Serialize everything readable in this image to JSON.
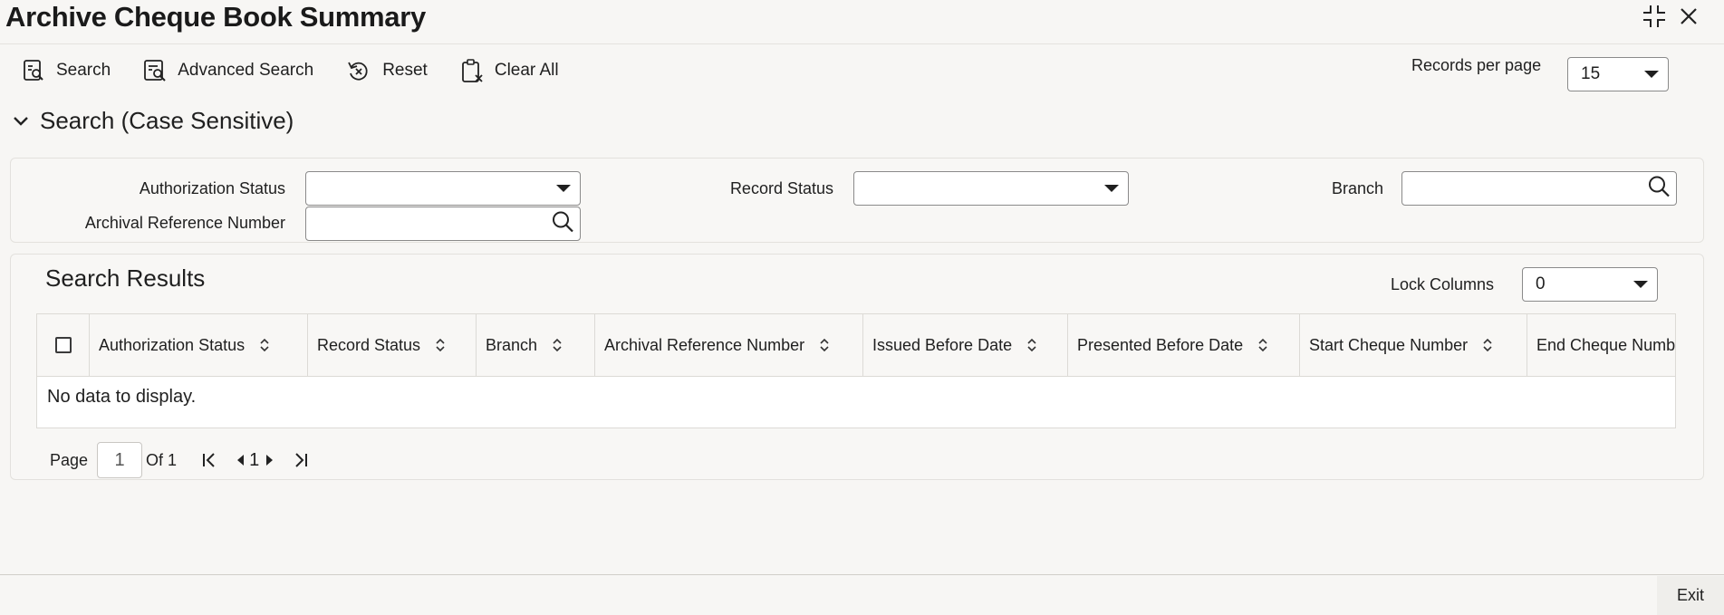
{
  "window": {
    "title": "Archive Cheque Book Summary",
    "icons": {
      "minimize": "minimize-icon",
      "close": "close-icon"
    }
  },
  "toolbar": {
    "search_label": "Search",
    "advanced_search_label": "Advanced Search",
    "reset_label": "Reset",
    "clear_all_label": "Clear All",
    "records_per_page_label": "Records per page",
    "records_per_page_value": "15"
  },
  "search_section": {
    "title": "Search (Case Sensitive)",
    "fields": {
      "authorization_status": {
        "label": "Authorization Status",
        "value": ""
      },
      "record_status": {
        "label": "Record Status",
        "value": ""
      },
      "branch": {
        "label": "Branch",
        "value": ""
      },
      "archival_reference_number": {
        "label": "Archival Reference Number",
        "value": ""
      }
    }
  },
  "results": {
    "title": "Search Results",
    "lock_columns_label": "Lock Columns",
    "lock_columns_value": "0",
    "columns": [
      "Authorization Status",
      "Record Status",
      "Branch",
      "Archival Reference Number",
      "Issued Before Date",
      "Presented Before Date",
      "Start Cheque Number",
      "End Cheque Numbe"
    ],
    "empty_message": "No data to display."
  },
  "pagination": {
    "page_label": "Page",
    "current_page": "1",
    "of_label": "Of 1",
    "page_number": "1"
  },
  "footer": {
    "exit_label": "Exit"
  }
}
